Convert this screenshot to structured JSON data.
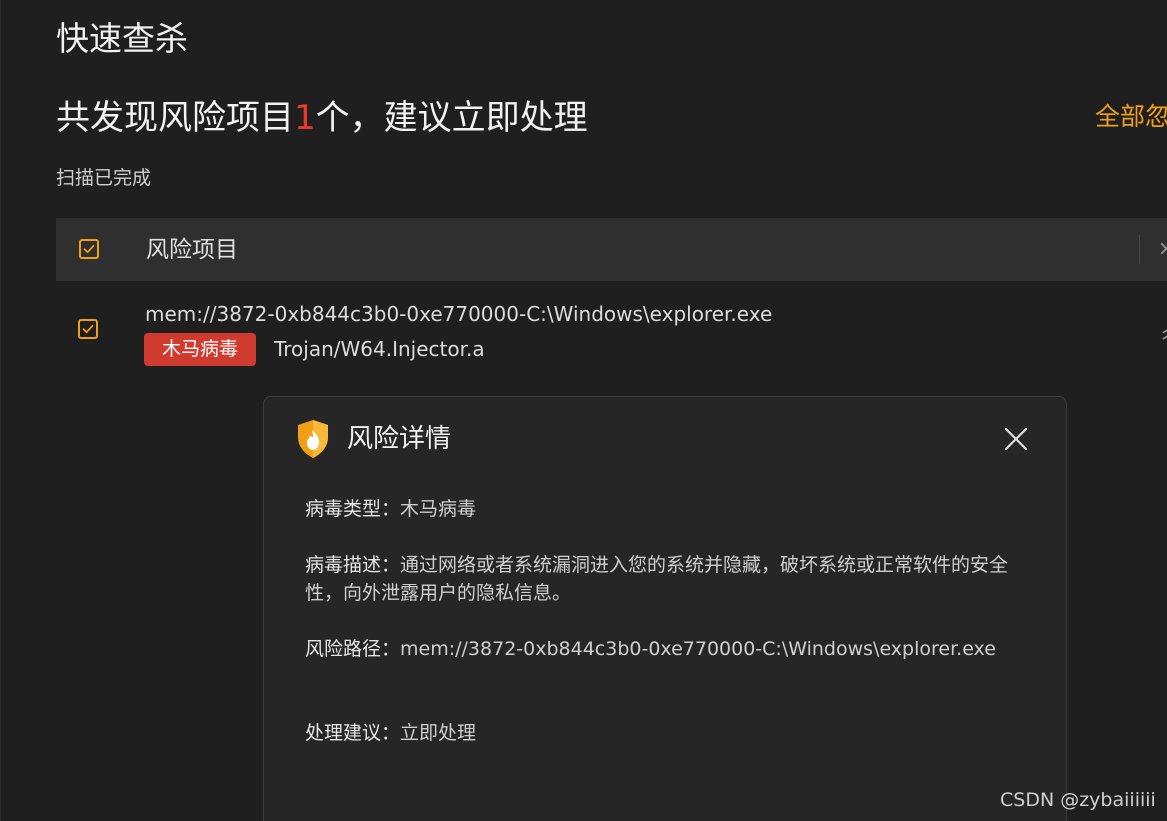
{
  "header": {
    "app_title": "快速查杀",
    "summary_prefix": "共发现风险项目",
    "summary_count": "1",
    "summary_suffix": "个，建议立即处理",
    "ignore_all_label": "全部忽",
    "scan_status": "扫描已完成"
  },
  "table": {
    "column_risk_item": "风险项目",
    "column_cut_glyph": "×",
    "rows": [
      {
        "path": "mem://3872-0xb844c3b0-0xe770000-C:\\Windows\\explorer.exe",
        "category": "木马病毒",
        "virus_name": "Trojan/W64.Injector.a",
        "right_cut_glyph": "彳"
      }
    ]
  },
  "dialog": {
    "title": "风险详情",
    "fields": [
      {
        "key": "病毒类型：",
        "value": "木马病毒"
      },
      {
        "key": "病毒描述：",
        "value": "通过网络或者系统漏洞进入您的系统并隐藏，破坏系统或正常软件的安全性，向外泄露用户的隐私信息。"
      },
      {
        "key": "风险路径：",
        "value": "mem://3872-0xb844c3b0-0xe770000-C:\\Windows\\explorer.exe"
      },
      {
        "key": "处理建议：",
        "value": "立即处理"
      }
    ]
  },
  "watermark": "CSDN @zybaiiiiii",
  "colors": {
    "background": "#1f1f1f",
    "accent_orange": "#f0a017",
    "danger_red": "#cf3b2f",
    "count_red": "#e8392c"
  },
  "icons": {
    "checkbox": "checkbox-checked-icon",
    "shield": "shield-fire-icon",
    "close": "close-icon"
  }
}
